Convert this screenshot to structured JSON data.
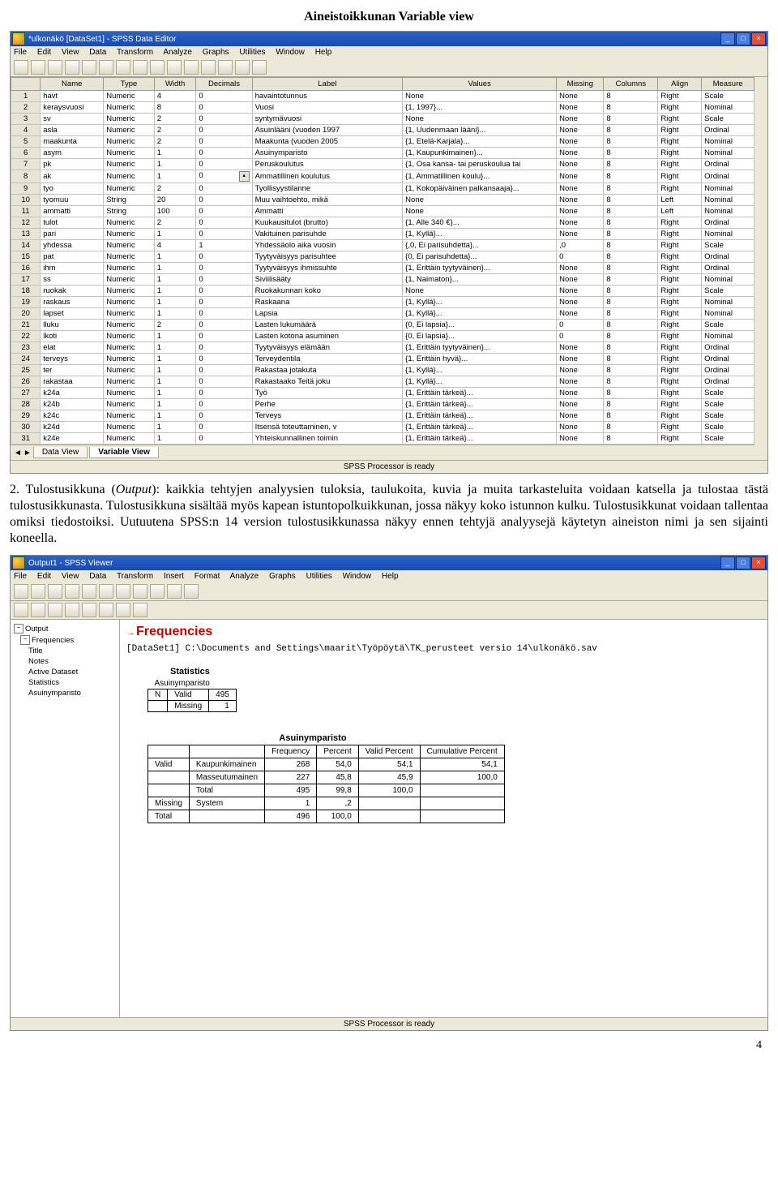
{
  "doc": {
    "heading": "Aineistoikkunan Variable view",
    "para1_a": "2. Tulostusikkuna (",
    "para1_b": "Output",
    "para1_c": "): kaikkia tehtyjen analyysien tuloksia, taulukoita, kuvia ja muita tarkasteluita voidaan katsella ja tulostaa tästä tulostusikkunasta. Tulostusikkuna sisältää myös kapean istuntopolkuikkunan, jossa näkyy koko istunnon kulku. Tulostusikkunat voidaan tallentaa omiksi tiedostoiksi. Uutuutena SPSS:n 14 version tulostusikkunassa näkyy ennen tehtyjä analyysejä käytetyn aineiston nimi ja sen sijainti koneella.",
    "page_num": "4"
  },
  "editor": {
    "title": "*ulkonäkö [DataSet1] - SPSS Data Editor",
    "menus": [
      "File",
      "Edit",
      "View",
      "Data",
      "Transform",
      "Analyze",
      "Graphs",
      "Utilities",
      "Window",
      "Help"
    ],
    "headers": [
      "",
      "Name",
      "Type",
      "Width",
      "Decimals",
      "Label",
      "Values",
      "Missing",
      "Columns",
      "Align",
      "Measure"
    ],
    "tabs": {
      "scroll_l": "◄",
      "scroll_r": "►",
      "data": "Data View",
      "var": "Variable View"
    },
    "status": "SPSS Processor is ready",
    "rows": [
      {
        "n": "1",
        "name": "havt",
        "type": "Numeric",
        "w": "4",
        "d": "0",
        "label": "havaintotunnus",
        "values": "None",
        "miss": "None",
        "cols": "8",
        "align": "Right",
        "meas": "Scale"
      },
      {
        "n": "2",
        "name": "keraysvuosi",
        "type": "Numeric",
        "w": "8",
        "d": "0",
        "label": "Vuosi",
        "values": "{1, 1997}...",
        "miss": "None",
        "cols": "8",
        "align": "Right",
        "meas": "Nominal"
      },
      {
        "n": "3",
        "name": "sv",
        "type": "Numeric",
        "w": "2",
        "d": "0",
        "label": "syntymävuosi",
        "values": "None",
        "miss": "None",
        "cols": "8",
        "align": "Right",
        "meas": "Scale"
      },
      {
        "n": "4",
        "name": "asla",
        "type": "Numeric",
        "w": "2",
        "d": "0",
        "label": "Asuinlääni (vuoden 1997",
        "values": "{1, Uudenmaan lääni}...",
        "miss": "None",
        "cols": "8",
        "align": "Right",
        "meas": "Ordinal"
      },
      {
        "n": "5",
        "name": "maakunta",
        "type": "Numeric",
        "w": "2",
        "d": "0",
        "label": "Maakunta (vuoden 2005",
        "values": "{1, Etelä-Karjala}...",
        "miss": "None",
        "cols": "8",
        "align": "Right",
        "meas": "Nominal"
      },
      {
        "n": "6",
        "name": "asym",
        "type": "Numeric",
        "w": "1",
        "d": "0",
        "label": "Asuinymparisto",
        "values": "{1, Kaupunkimainen}...",
        "miss": "None",
        "cols": "8",
        "align": "Right",
        "meas": "Nominal"
      },
      {
        "n": "7",
        "name": "pk",
        "type": "Numeric",
        "w": "1",
        "d": "0",
        "label": "Peruskoulutus",
        "values": "{1, Osa kansa- tai peruskoulua tai",
        "miss": "None",
        "cols": "8",
        "align": "Right",
        "meas": "Ordinal"
      },
      {
        "n": "8",
        "name": "ak",
        "type": "Numeric",
        "w": "1",
        "d": "0",
        "label": "Ammatillinen koulutus",
        "values": "{1, Ammatillinen koulu}...",
        "miss": "None",
        "cols": "8",
        "align": "Right",
        "meas": "Ordinal",
        "spin": true
      },
      {
        "n": "9",
        "name": "tyo",
        "type": "Numeric",
        "w": "2",
        "d": "0",
        "label": "Tyollisyystilanne",
        "values": "{1, Kokopäiväinen palkansaaja}...",
        "miss": "None",
        "cols": "8",
        "align": "Right",
        "meas": "Nominal"
      },
      {
        "n": "10",
        "name": "tyomuu",
        "type": "String",
        "w": "20",
        "d": "0",
        "label": "Muu vaihtoehto, mikä",
        "values": "None",
        "miss": "None",
        "cols": "8",
        "align": "Left",
        "meas": "Nominal"
      },
      {
        "n": "11",
        "name": "ammatti",
        "type": "String",
        "w": "100",
        "d": "0",
        "label": "Ammatti",
        "values": "None",
        "miss": "None",
        "cols": "8",
        "align": "Left",
        "meas": "Nominal"
      },
      {
        "n": "12",
        "name": "tulot",
        "type": "Numeric",
        "w": "2",
        "d": "0",
        "label": "Kuukausitulot (brutto)",
        "values": "{1, Alle 340 €}...",
        "miss": "None",
        "cols": "8",
        "align": "Right",
        "meas": "Ordinal"
      },
      {
        "n": "13",
        "name": "pari",
        "type": "Numeric",
        "w": "1",
        "d": "0",
        "label": "Vakituinen parisuhde",
        "values": "{1, Kyllä}...",
        "miss": "None",
        "cols": "8",
        "align": "Right",
        "meas": "Nominal"
      },
      {
        "n": "14",
        "name": "yhdessa",
        "type": "Numeric",
        "w": "4",
        "d": "1",
        "label": "Yhdessäolo aika vuosin",
        "values": "{,0, Ei parisuhdetta}...",
        "miss": ",0",
        "cols": "8",
        "align": "Right",
        "meas": "Scale"
      },
      {
        "n": "15",
        "name": "pat",
        "type": "Numeric",
        "w": "1",
        "d": "0",
        "label": "Tyytyväisyys parisuhtee",
        "values": "{0, Ei parisuhdetta}...",
        "miss": "0",
        "cols": "8",
        "align": "Right",
        "meas": "Ordinal"
      },
      {
        "n": "16",
        "name": "ihm",
        "type": "Numeric",
        "w": "1",
        "d": "0",
        "label": "Tyytyväisyys ihmissuhte",
        "values": "{1, Erittäin tyytyväinen}...",
        "miss": "None",
        "cols": "8",
        "align": "Right",
        "meas": "Ordinal"
      },
      {
        "n": "17",
        "name": "ss",
        "type": "Numeric",
        "w": "1",
        "d": "0",
        "label": "Siviilisääty",
        "values": "{1, Naimaton}...",
        "miss": "None",
        "cols": "8",
        "align": "Right",
        "meas": "Nominal"
      },
      {
        "n": "18",
        "name": "ruokak",
        "type": "Numeric",
        "w": "1",
        "d": "0",
        "label": "Ruokakunnan koko",
        "values": "None",
        "miss": "None",
        "cols": "8",
        "align": "Right",
        "meas": "Scale"
      },
      {
        "n": "19",
        "name": "raskaus",
        "type": "Numeric",
        "w": "1",
        "d": "0",
        "label": "Raskaana",
        "values": "{1, Kyllä}...",
        "miss": "None",
        "cols": "8",
        "align": "Right",
        "meas": "Nominal"
      },
      {
        "n": "20",
        "name": "lapset",
        "type": "Numeric",
        "w": "1",
        "d": "0",
        "label": "Lapsia",
        "values": "{1, Kyllä}...",
        "miss": "None",
        "cols": "8",
        "align": "Right",
        "meas": "Nominal"
      },
      {
        "n": "21",
        "name": "lluku",
        "type": "Numeric",
        "w": "2",
        "d": "0",
        "label": "Lasten lukumäärä",
        "values": "{0, Ei lapsia}...",
        "miss": "0",
        "cols": "8",
        "align": "Right",
        "meas": "Scale"
      },
      {
        "n": "22",
        "name": "lkoti",
        "type": "Numeric",
        "w": "1",
        "d": "0",
        "label": "Lasten kotona asuminen",
        "values": "{0, Ei lapsia}...",
        "miss": "0",
        "cols": "8",
        "align": "Right",
        "meas": "Nominal"
      },
      {
        "n": "23",
        "name": "elat",
        "type": "Numeric",
        "w": "1",
        "d": "0",
        "label": "Tyytyväisyys elämään",
        "values": "{1, Erittäin tyytyväinen}...",
        "miss": "None",
        "cols": "8",
        "align": "Right",
        "meas": "Ordinal"
      },
      {
        "n": "24",
        "name": "terveys",
        "type": "Numeric",
        "w": "1",
        "d": "0",
        "label": "Terveydentila",
        "values": "{1, Erittäin hyvä}...",
        "miss": "None",
        "cols": "8",
        "align": "Right",
        "meas": "Ordinal"
      },
      {
        "n": "25",
        "name": "ter",
        "type": "Numeric",
        "w": "1",
        "d": "0",
        "label": "Rakastaa jotakuta",
        "values": "{1, Kyllä}...",
        "miss": "None",
        "cols": "8",
        "align": "Right",
        "meas": "Ordinal"
      },
      {
        "n": "26",
        "name": "rakastaa",
        "type": "Numeric",
        "w": "1",
        "d": "0",
        "label": "Rakastaako Teitä joku",
        "values": "{1, Kyllä}...",
        "miss": "None",
        "cols": "8",
        "align": "Right",
        "meas": "Ordinal"
      },
      {
        "n": "27",
        "name": "k24a",
        "type": "Numeric",
        "w": "1",
        "d": "0",
        "label": "Työ",
        "values": "{1, Erittäin tärkeä}...",
        "miss": "None",
        "cols": "8",
        "align": "Right",
        "meas": "Scale"
      },
      {
        "n": "28",
        "name": "k24b",
        "type": "Numeric",
        "w": "1",
        "d": "0",
        "label": "Perhe",
        "values": "{1, Erittäin tärkeä}...",
        "miss": "None",
        "cols": "8",
        "align": "Right",
        "meas": "Scale"
      },
      {
        "n": "29",
        "name": "k24c",
        "type": "Numeric",
        "w": "1",
        "d": "0",
        "label": "Terveys",
        "values": "{1, Erittäin tärkeä}...",
        "miss": "None",
        "cols": "8",
        "align": "Right",
        "meas": "Scale"
      },
      {
        "n": "30",
        "name": "k24d",
        "type": "Numeric",
        "w": "1",
        "d": "0",
        "label": "Itsensä toteuttaminen, v",
        "values": "{1, Erittäin tärkeä}...",
        "miss": "None",
        "cols": "8",
        "align": "Right",
        "meas": "Scale"
      },
      {
        "n": "31",
        "name": "k24e",
        "type": "Numeric",
        "w": "1",
        "d": "0",
        "label": "Yhteiskunnallinen toimin",
        "values": "{1, Erittäin tärkeä}...",
        "miss": "None",
        "cols": "8",
        "align": "Right",
        "meas": "Scale"
      }
    ]
  },
  "viewer": {
    "title": "Output1 - SPSS Viewer",
    "menus": [
      "File",
      "Edit",
      "View",
      "Data",
      "Transform",
      "Insert",
      "Format",
      "Analyze",
      "Graphs",
      "Utilities",
      "Window",
      "Help"
    ],
    "tree": {
      "root": "Output",
      "group": "Frequencies",
      "items": [
        "Title",
        "Notes",
        "Active Dataset",
        "Statistics",
        "Asuinymparisto"
      ]
    },
    "content": {
      "title": "Frequencies",
      "dataset_line": "[DataSet1] C:\\Documents and Settings\\maarit\\Työpöytä\\TK_perusteet versio 14\\ulkonäkö.sav",
      "stats_hdr": "Statistics",
      "stats_var": "Asuinymparisto",
      "stats_rows": [
        [
          "N",
          "Valid",
          "495"
        ],
        [
          "",
          "Missing",
          "1"
        ]
      ],
      "result_title": "Asuinymparisto",
      "result_headers": [
        "",
        "",
        "Frequency",
        "Percent",
        "Valid Percent",
        "Cumulative Percent"
      ],
      "result_rows": [
        [
          "Valid",
          "Kaupunkimainen",
          "268",
          "54,0",
          "54,1",
          "54,1"
        ],
        [
          "",
          "Masseutumainen",
          "227",
          "45,8",
          "45,9",
          "100,0"
        ],
        [
          "",
          "Total",
          "495",
          "99,8",
          "100,0",
          ""
        ],
        [
          "Missing",
          "System",
          "1",
          ",2",
          "",
          ""
        ],
        [
          "Total",
          "",
          "496",
          "100,0",
          "",
          ""
        ]
      ]
    },
    "status": "SPSS Processor is ready"
  }
}
